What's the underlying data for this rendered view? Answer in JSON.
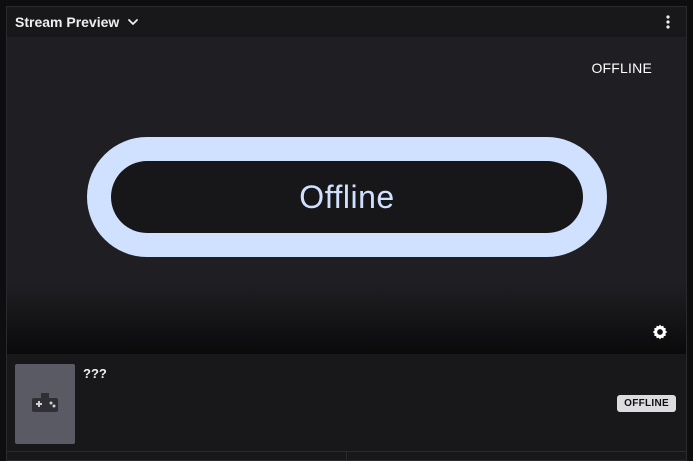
{
  "header": {
    "title": "Stream Preview",
    "dropdown_icon": "chevron-down-icon",
    "menu_icon": "more-vertical-icon"
  },
  "video": {
    "status_label": "OFFLINE",
    "placeholder_text": "Offline",
    "settings_icon": "gear-icon"
  },
  "stream_info": {
    "title": "???",
    "thumbnail_icon": "gamepad-icon",
    "badge": "OFFLINE"
  },
  "colors": {
    "accent": "#9147ff",
    "pill": "#cfe1ff",
    "background": "#18181b"
  }
}
